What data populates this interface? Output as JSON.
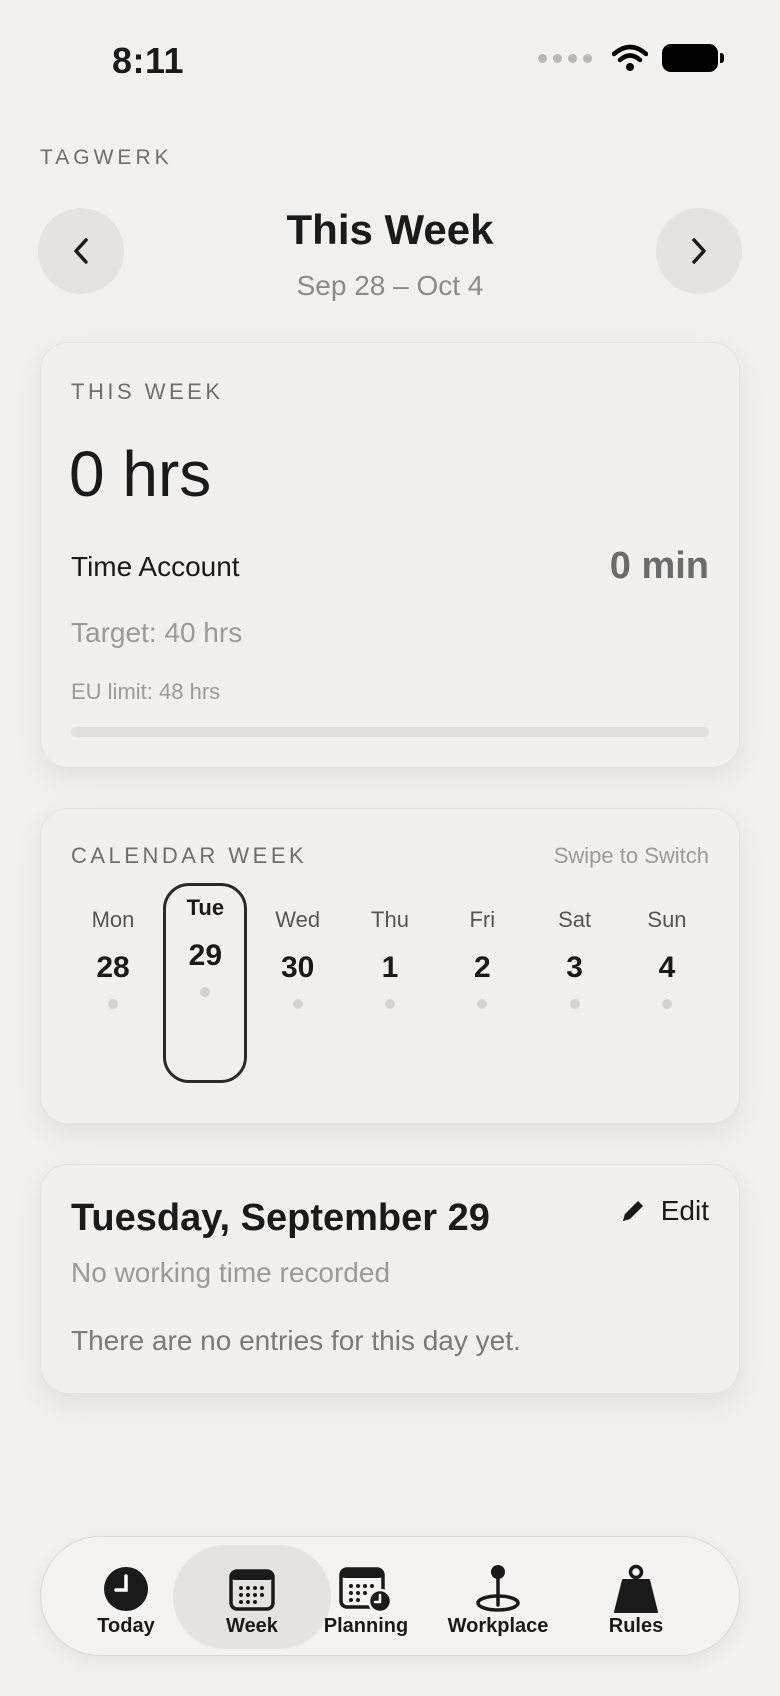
{
  "status_bar": {
    "time": "8:11"
  },
  "brand": "TAGWERK",
  "header": {
    "title": "This Week",
    "range": "Sep 28 – Oct 4"
  },
  "summary": {
    "label": "THIS WEEK",
    "hours": "0 hrs",
    "account_label": "Time Account",
    "account_value": "0 min",
    "target": "Target: 40 hrs",
    "eu_limit": "EU limit: 48 hrs",
    "progress_fraction": 0
  },
  "calendar": {
    "label": "CALENDAR WEEK",
    "hint": "Swipe to Switch",
    "days": [
      {
        "name": "Mon",
        "date": "28"
      },
      {
        "name": "Tue",
        "date": "29"
      },
      {
        "name": "Wed",
        "date": "30"
      },
      {
        "name": "Thu",
        "date": "1"
      },
      {
        "name": "Fri",
        "date": "2"
      },
      {
        "name": "Sat",
        "date": "3"
      },
      {
        "name": "Sun",
        "date": "4"
      }
    ],
    "selected_index": 1
  },
  "day_detail": {
    "title": "Tuesday, September 29",
    "edit_label": "Edit",
    "subtitle": "No working time recorded",
    "empty_text": "There are no entries for this day yet."
  },
  "tabs": [
    {
      "label": "Today",
      "icon": "clock-icon"
    },
    {
      "label": "Week",
      "icon": "calendar-grid-icon"
    },
    {
      "label": "Planning",
      "icon": "calendar-clock-icon"
    },
    {
      "label": "Workplace",
      "icon": "location-pin-icon"
    },
    {
      "label": "Rules",
      "icon": "weight-icon"
    }
  ],
  "active_tab": 1
}
